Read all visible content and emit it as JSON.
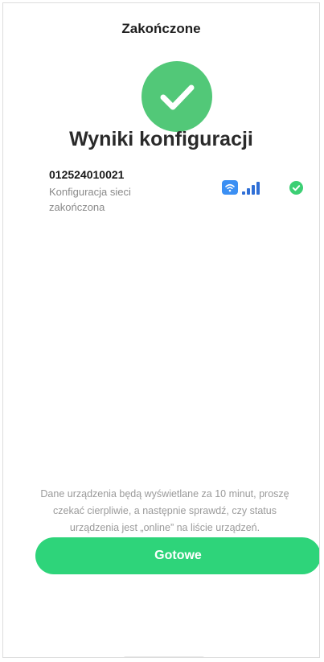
{
  "header": {
    "title": "Zakończone"
  },
  "result": {
    "title": "Wyniki konfiguracji",
    "success_icon": "check-circle-icon"
  },
  "device": {
    "id": "012524010021",
    "status": "Konfiguracja sieci zakończona",
    "wifi_icon": "wifi-icon",
    "signal_icon": "signal-strength-icon",
    "status_icon": "check-icon"
  },
  "note": {
    "text": "Dane urządzenia będą wyświetlane za 10 minut, proszę czekać cierpliwie, a następnie sprawdź, czy status urządzenia jest „online” na liście urządzeń."
  },
  "actions": {
    "done_label": "Gotowe"
  },
  "colors": {
    "success": "#52c878",
    "button": "#2ed47a",
    "wifi": "#3b8ff3",
    "signal": "#2f6fd6"
  }
}
